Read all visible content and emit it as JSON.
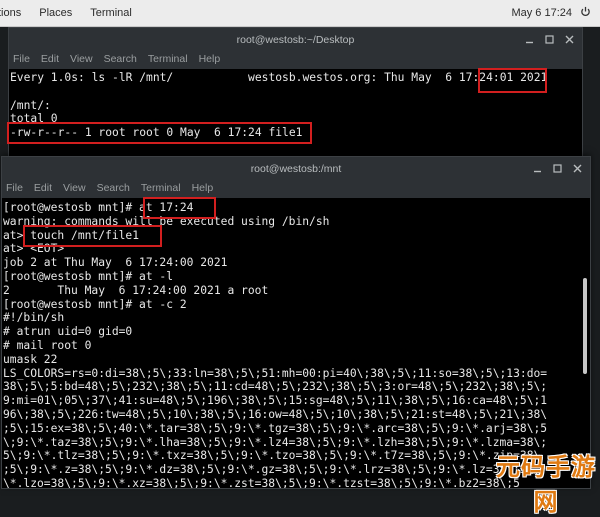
{
  "topbar": {
    "menus": [
      "tions",
      "Places",
      "Terminal"
    ],
    "clock": "May 6  17:24"
  },
  "window1": {
    "title": "root@westosb:~/Desktop",
    "menu": [
      "File",
      "Edit",
      "View",
      "Search",
      "Terminal",
      "Help"
    ],
    "lines": [
      "Every 1.0s: ls -lR /mnt/           westosb.westos.org: Thu May  6 17:24:01 2021",
      "",
      "/mnt/:",
      "total 0",
      "-rw-r--r-- 1 root root 0 May  6 17:24 file1"
    ]
  },
  "window2": {
    "title": "root@westosb:/mnt",
    "menu": [
      "File",
      "Edit",
      "View",
      "Search",
      "Terminal",
      "Help"
    ],
    "lines": [
      "[root@westosb mnt]# at 17:24",
      "warning: commands will be executed using /bin/sh",
      "at> touch /mnt/file1",
      "at> <EOT>",
      "job 2 at Thu May  6 17:24:00 2021",
      "[root@westosb mnt]# at -l",
      "2       Thu May  6 17:24:00 2021 a root",
      "[root@westosb mnt]# at -c 2",
      "#!/bin/sh",
      "# atrun uid=0 gid=0",
      "# mail root 0",
      "umask 22",
      "LS_COLORS=rs=0:di=38\\;5\\;33:ln=38\\;5\\;51:mh=00:pi=40\\;38\\;5\\;11:so=38\\;5\\;13:do=",
      "38\\;5\\;5:bd=48\\;5\\;232\\;38\\;5\\;11:cd=48\\;5\\;232\\;38\\;5\\;3:or=48\\;5\\;232\\;38\\;5\\;",
      "9:mi=01\\;05\\;37\\;41:su=48\\;5\\;196\\;38\\;5\\;15:sg=48\\;5\\;11\\;38\\;5\\;16:ca=48\\;5\\;1",
      "96\\;38\\;5\\;226:tw=48\\;5\\;10\\;38\\;5\\;16:ow=48\\;5\\;10\\;38\\;5\\;21:st=48\\;5\\;21\\;38\\",
      ";5\\;15:ex=38\\;5\\;40:\\*.tar=38\\;5\\;9:\\*.tgz=38\\;5\\;9:\\*.arc=38\\;5\\;9:\\*.arj=38\\;5",
      "\\;9:\\*.taz=38\\;5\\;9:\\*.lha=38\\;5\\;9:\\*.lz4=38\\;5\\;9:\\*.lzh=38\\;5\\;9:\\*.lzma=38\\;",
      "5\\;9:\\*.tlz=38\\;5\\;9:\\*.txz=38\\;5\\;9:\\*.tzo=38\\;5\\;9:\\*.t7z=38\\;5\\;9:\\*.zip=38\\",
      ";5\\;9:\\*.z=38\\;5\\;9:\\*.dz=38\\;5\\;9:\\*.gz=38\\;5\\;9:\\*.lrz=38\\;5\\;9:\\*.lz=38\\;5\\;",
      "\\*.lzo=38\\;5\\;9:\\*.xz=38\\;5\\;9:\\*.zst=38\\;5\\;9:\\*.tzst=38\\;5\\;9:\\*.bz2=38\\;5"
    ]
  },
  "watermark": {
    "text": "元码手游网"
  },
  "colors": {
    "highlight": "#d21f1f",
    "terminal_bg": "#000000",
    "watermark": "#e07a12"
  },
  "icons": {
    "power": "power-icon",
    "minimize": "minimize-icon",
    "maximize": "maximize-icon",
    "close": "close-icon"
  }
}
